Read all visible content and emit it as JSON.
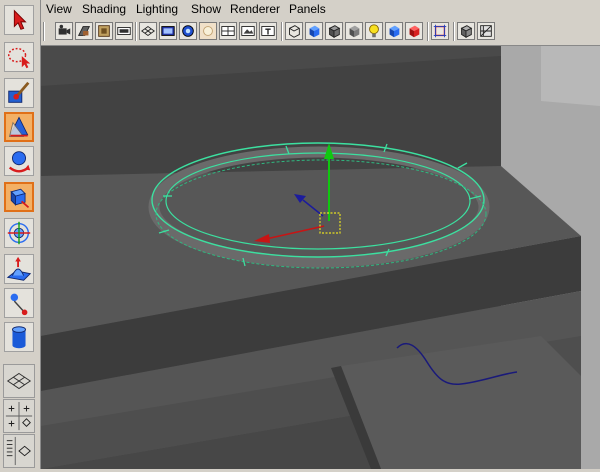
{
  "menu": {
    "items": [
      {
        "label": "View"
      },
      {
        "label": "Shading"
      },
      {
        "label": "Lighting"
      },
      {
        "label": "Show"
      },
      {
        "label": "Renderer"
      },
      {
        "label": "Panels"
      }
    ]
  },
  "toolbox": {
    "tools": [
      {
        "icon": "select-arrow-icon",
        "active": false
      },
      {
        "icon": "lasso-select-icon",
        "active": false
      },
      {
        "icon": "paint-select-icon",
        "active": false
      },
      {
        "icon": "move-tool-icon",
        "active": true
      },
      {
        "icon": "rotate-tool-icon",
        "active": false
      },
      {
        "icon": "scale-tool-icon",
        "active": true
      },
      {
        "icon": "universal-manipulator-icon",
        "active": false
      },
      {
        "icon": "soft-modification-icon",
        "active": false
      },
      {
        "icon": "show-manipulator-icon",
        "active": false
      },
      {
        "icon": "last-tool-cylinder-icon",
        "active": false
      }
    ],
    "layouts": [
      {
        "icon": "single-pane-layout-icon"
      },
      {
        "icon": "four-pane-layout-icon"
      },
      {
        "icon": "outliner-persp-layout-icon"
      }
    ]
  },
  "panel_icons": [
    "select-camera-icon",
    "camera-attributes-icon",
    "bookmark-icon",
    "image-plane-icon",
    "grid-icon",
    "film-gate-icon",
    "resolution-gate-icon",
    "gate-mask-icon",
    "field-chart-icon",
    "safe-action-icon",
    "safe-title-icon",
    "wireframe-icon",
    "smooth-shade-all-icon",
    "wireframe-on-shaded-icon",
    "use-default-material-icon",
    "use-all-lights-icon",
    "shadows-icon",
    "textured-icon",
    "isolate-select-icon",
    "xray-icon",
    "xray-joints-icon"
  ],
  "colors": {
    "viewport_bg": "#474747",
    "curve_highlight": "#3ce0a0",
    "move_x": "#c81414",
    "move_y": "#10c810",
    "move_z": "#1c1c9c",
    "pivot": "#e8e020",
    "nurbs_curve": "#1a1a7a",
    "active_tool": "#f3b065"
  }
}
